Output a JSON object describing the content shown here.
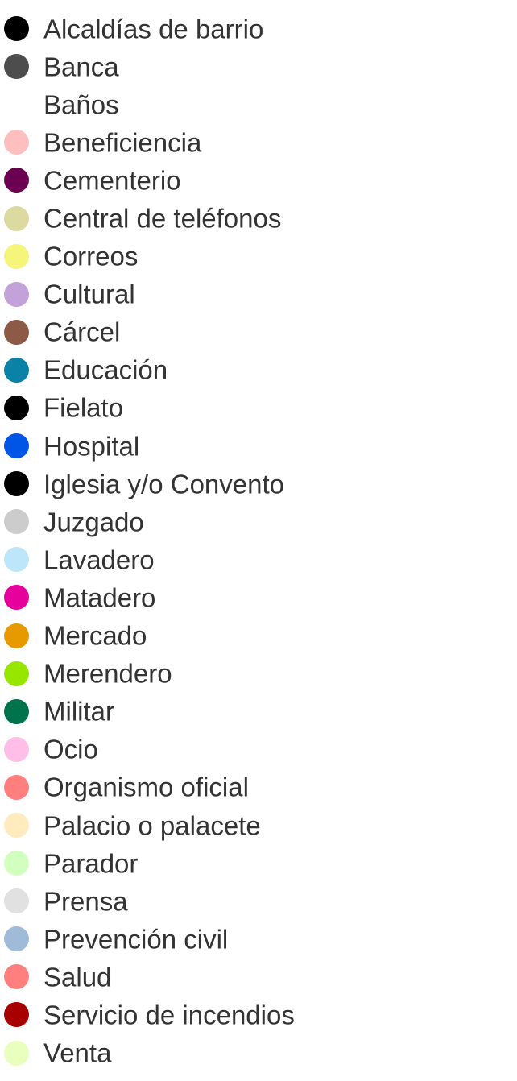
{
  "legend": {
    "items": [
      {
        "label": "Alcaldías de barrio",
        "color": "#000000"
      },
      {
        "label": "Banca",
        "color": "#4d4d4d"
      },
      {
        "label": "Baños",
        "color": "#ffffff"
      },
      {
        "label": "Beneficiencia",
        "color": "#ffbfbf"
      },
      {
        "label": "Cementerio",
        "color": "#6b0050"
      },
      {
        "label": "Central de teléfonos",
        "color": "#dcdaa0"
      },
      {
        "label": "Correos",
        "color": "#f5f57a"
      },
      {
        "label": "Cultural",
        "color": "#c3a2d9"
      },
      {
        "label": "Cárcel",
        "color": "#8c5a46"
      },
      {
        "label": "Educación",
        "color": "#0a82a5"
      },
      {
        "label": "Fielato",
        "color": "#000000"
      },
      {
        "label": "Hospital",
        "color": "#0055e6"
      },
      {
        "label": "Iglesia y/o Convento",
        "color": "#000000"
      },
      {
        "label": "Juzgado",
        "color": "#cccccc"
      },
      {
        "label": "Lavadero",
        "color": "#bde6fa"
      },
      {
        "label": "Matadero",
        "color": "#e6009c"
      },
      {
        "label": "Mercado",
        "color": "#e69a00"
      },
      {
        "label": "Merendero",
        "color": "#96e600"
      },
      {
        "label": "Militar",
        "color": "#00734c"
      },
      {
        "label": "Ocio",
        "color": "#ffbee8"
      },
      {
        "label": "Organismo oficial",
        "color": "#ff7f7f"
      },
      {
        "label": "Palacio o palacete",
        "color": "#ffebbe"
      },
      {
        "label": "Parador",
        "color": "#d3ffbe"
      },
      {
        "label": "Prensa",
        "color": "#e1e1e1"
      },
      {
        "label": "Prevención civil",
        "color": "#9fbbd8"
      },
      {
        "label": "Salud",
        "color": "#ff7f7f"
      },
      {
        "label": "Servicio de incendios",
        "color": "#a80000"
      },
      {
        "label": "Venta",
        "color": "#e9ffbe"
      }
    ]
  }
}
